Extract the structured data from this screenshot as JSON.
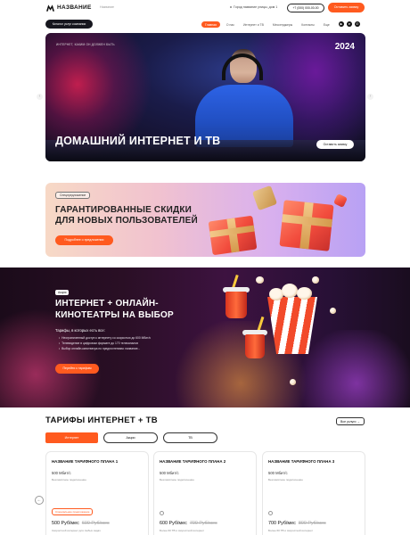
{
  "header": {
    "logo_text": "НАЗВАНИЕ",
    "subtitle": "Название",
    "location": "Город название улицы, дом 1",
    "phone": "+7 (000) 000-00-00",
    "cta": "Оставить заявку"
  },
  "nav": {
    "catalog": "Каталог услуг компании",
    "items": [
      "Главная",
      "О нас",
      "Интернет и ТВ",
      "Мессенджеры",
      "Контакты",
      "Еще"
    ]
  },
  "hero": {
    "kicker": "ИНТЕРНЕТ, КАКИМ ОН ДОЛЖЕН БЫТЬ",
    "year": "2024",
    "title": "ДОМАШНИЙ ИНТЕРНЕТ И ТВ",
    "button": "Оставить заявку"
  },
  "promo": {
    "tag": "Спецпредложение",
    "title_line1": "ГАРАНТИРОВАННЫЕ СКИДКИ",
    "title_line2": "ДЛЯ НОВЫХ ПОЛЬЗОВАТЕЛЕЙ",
    "button": "Подробнее о предложении"
  },
  "cinema": {
    "tag": "Акция",
    "title_line1": "ИНТЕРНЕТ + ОНЛАЙН-",
    "title_line2": "КИНОТЕАТРЫ НА ВЫБОР",
    "subtitle": "Тарифы, в которых есть все:",
    "bullets": [
      "Неограниченный доступ к интернету со скоростью до 600 Мбит/с",
      "Телевидение в цифровом формате до 170 телеканалов",
      "Выбор онлайн-кинотеатра по предпочтениям: название..."
    ],
    "button": "Перейти к тарифам"
  },
  "tariffs": {
    "title": "ТАРИФЫ ИНТЕРНЕТ + ТВ",
    "all_button": "Все услуги →",
    "tabs": [
      "Интернет",
      "Акции",
      "ТВ"
    ],
    "cards": [
      {
        "name": "НАЗВАНИЕ ТАРИФНОГО ПЛАНА 1",
        "speed": "500 Мбит/с",
        "conn": "Безлимитное подключение",
        "badge": "Специальное предложение",
        "price": "500 Руб/мес",
        "old": "600 Руб/мес",
        "note": "Скоростной интернет для любых задач"
      },
      {
        "name": "НАЗВАНИЕ ТАРИФНОГО ПЛАНА 2",
        "speed": "500 Мбит/с",
        "conn": "Безлимитное подключение",
        "price": "600 Руб/мес",
        "old": "700 Руб/мес",
        "note": "Более 60 ТВ и скоростной интернет"
      },
      {
        "name": "НАЗВАНИЕ ТАРИФНОГО ПЛАНА 3",
        "speed": "500 Мбит/с",
        "conn": "Безлимитное подключение",
        "price": "700 Руб/мес",
        "old": "800 Руб/мес",
        "note": "Более 60 ТВ и скоростной интернет"
      }
    ]
  },
  "icons": {
    "logo": "m-logo-icon",
    "youtube": "youtube-icon",
    "telegram": "telegram-icon",
    "whatsapp": "whatsapp-icon",
    "arrow_left": "chevron-left-icon",
    "arrow_right": "chevron-right-icon"
  },
  "colors": {
    "accent": "#ff5a1f",
    "dark": "#16161e"
  }
}
